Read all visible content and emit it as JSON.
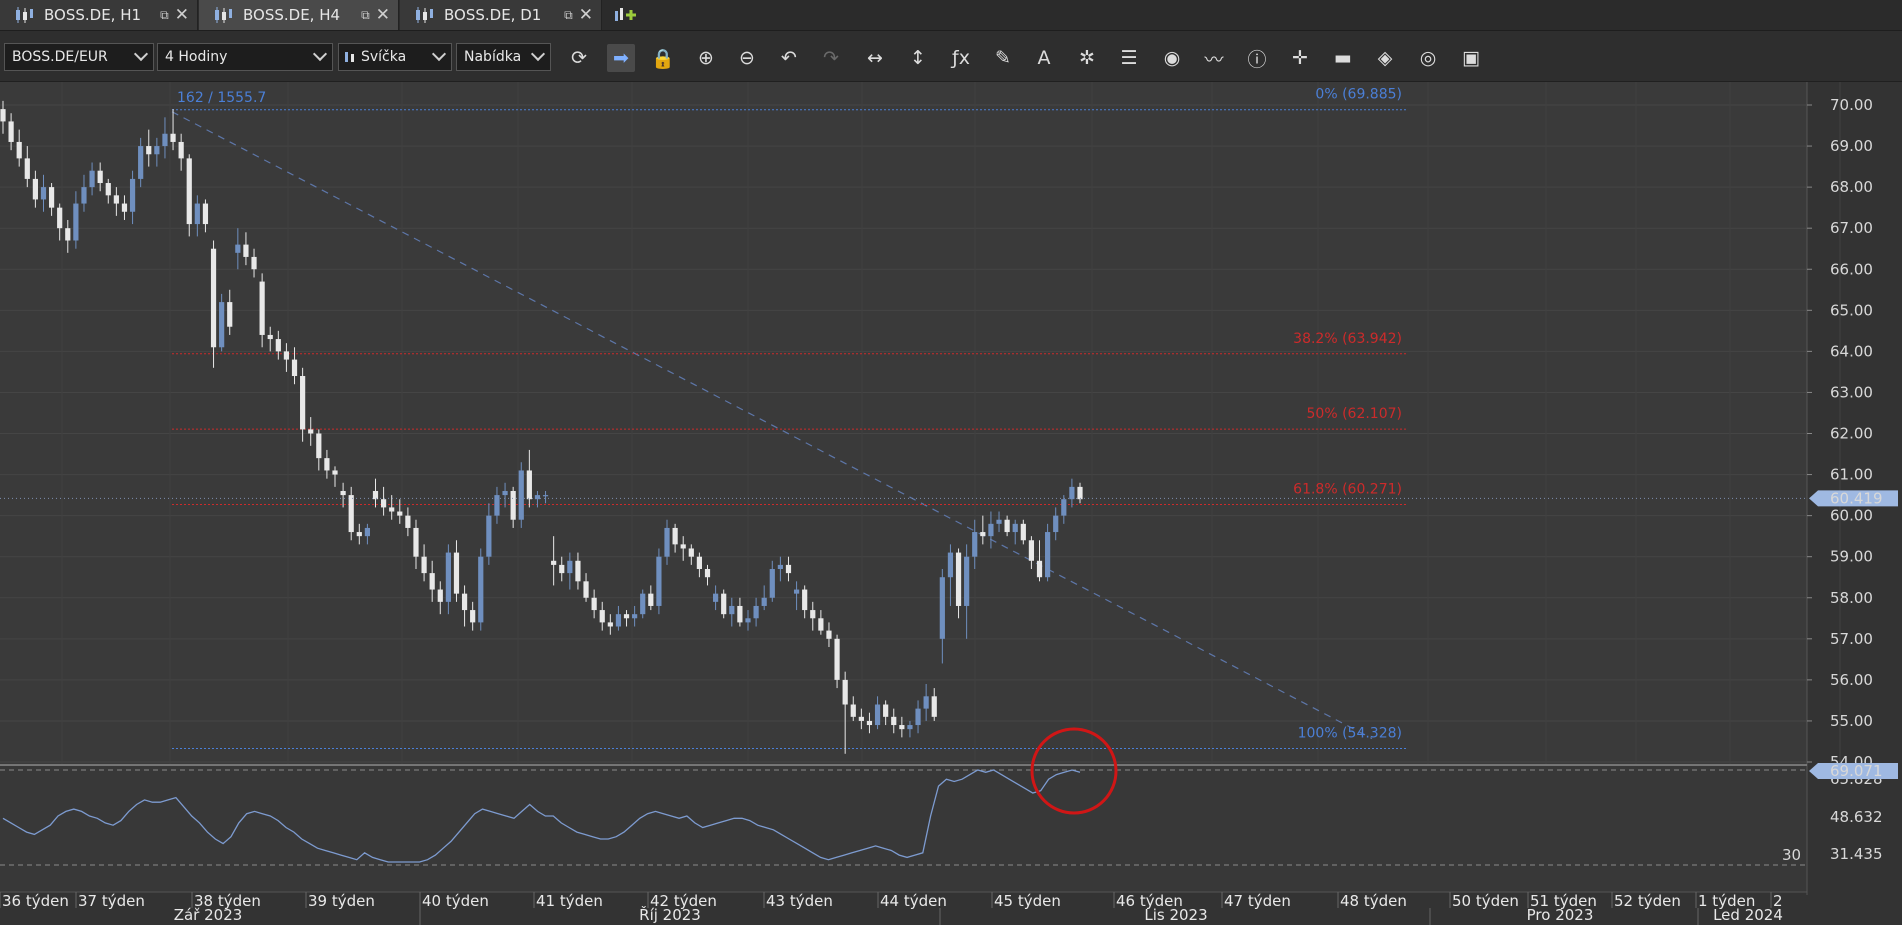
{
  "tabs": [
    {
      "label": "BOSS.DE, H1",
      "active": false
    },
    {
      "label": "BOSS.DE, H4",
      "active": true
    },
    {
      "label": "BOSS.DE, D1",
      "active": false
    }
  ],
  "toolbar": {
    "instrument": "BOSS.DE/EUR",
    "period": "4 Hodiny",
    "chart_type": "Svíčka",
    "offer_side": "Nabídka",
    "icons": [
      "refresh-icon",
      "shift-chart-icon",
      "lock-icon",
      "zoom-in-icon",
      "zoom-out-icon",
      "undo-icon",
      "redo-icon",
      "horizontal-measure-icon",
      "vertical-measure-icon",
      "indicators-icon",
      "pencil-icon",
      "text-icon",
      "crosshair-tools-icon",
      "layers-icon",
      "eye-icon",
      "chart-pattern-icon",
      "info-icon",
      "cursor-icon",
      "color-bars-icon",
      "paint-bucket-icon",
      "cycle-icon",
      "save-icon"
    ]
  },
  "chart_data": {
    "type": "candlestick",
    "instrument": "BOSS.DE",
    "timeframe": "H4",
    "y_ticks": [
      70.0,
      69.0,
      68.0,
      67.0,
      66.0,
      65.0,
      64.0,
      63.0,
      62.0,
      61.0,
      60.0,
      59.0,
      58.0,
      57.0,
      56.0,
      55.0,
      54.0
    ],
    "y_tick_labels": [
      "70.00",
      "69.00",
      "68.00",
      "67.00",
      "66.00",
      "65.00",
      "64.00",
      "63.00",
      "62.00",
      "61.00",
      "60.00",
      "59.00",
      "58.00",
      "57.00",
      "56.00",
      "55.00",
      "54.00"
    ],
    "ylim": [
      54.0,
      70.35
    ],
    "current_price": 60.419,
    "current_price_label": "60.419",
    "fibonacci": {
      "note_label": "162 / 1555.7",
      "levels": [
        {
          "label": "0% (69.885)",
          "value": 69.885,
          "color": "#4b7fd6"
        },
        {
          "label": "38.2% (63.942)",
          "value": 63.942,
          "color": "#cc2b2b"
        },
        {
          "label": "50% (62.107)",
          "value": 62.107,
          "color": "#cc2b2b"
        },
        {
          "label": "61.8% (60.271)",
          "value": 60.271,
          "color": "#cc2b2b"
        },
        {
          "label": "100% (54.328)",
          "value": 54.328,
          "color": "#4b7fd6"
        }
      ]
    },
    "candles": [
      [
        69.9,
        70.1,
        69.3,
        69.6
      ],
      [
        69.6,
        69.8,
        68.9,
        69.1
      ],
      [
        69.1,
        69.4,
        68.5,
        68.7
      ],
      [
        68.7,
        69.0,
        68.0,
        68.2
      ],
      [
        68.2,
        68.4,
        67.5,
        67.7
      ],
      [
        67.7,
        68.3,
        67.4,
        68.0
      ],
      [
        68.0,
        68.1,
        67.3,
        67.5
      ],
      [
        67.5,
        67.6,
        66.7,
        67.0
      ],
      [
        67.0,
        67.2,
        66.4,
        66.7
      ],
      [
        66.7,
        67.9,
        66.5,
        67.6
      ],
      [
        67.6,
        68.3,
        67.4,
        68.0
      ],
      [
        68.0,
        68.6,
        67.8,
        68.4
      ],
      [
        68.4,
        68.6,
        67.9,
        68.1
      ],
      [
        68.1,
        68.2,
        67.6,
        67.8
      ],
      [
        67.8,
        68.0,
        67.3,
        67.6
      ],
      [
        67.6,
        67.8,
        67.2,
        67.4
      ],
      [
        67.4,
        68.4,
        67.1,
        68.2
      ],
      [
        68.2,
        69.2,
        68.0,
        69.0
      ],
      [
        69.0,
        69.4,
        68.5,
        68.8
      ],
      [
        68.8,
        69.2,
        68.5,
        69.0
      ],
      [
        69.0,
        69.7,
        68.7,
        69.3
      ],
      [
        69.3,
        69.9,
        68.9,
        69.1
      ],
      [
        69.1,
        69.3,
        68.4,
        68.7
      ],
      [
        68.7,
        68.8,
        66.8,
        67.1
      ],
      [
        67.1,
        67.8,
        66.8,
        67.6
      ],
      [
        67.6,
        67.7,
        66.9,
        67.1
      ],
      [
        66.5,
        66.7,
        63.6,
        64.1
      ],
      [
        64.1,
        65.4,
        64.0,
        65.2
      ],
      [
        65.2,
        65.5,
        64.4,
        64.6
      ],
      [
        66.4,
        67.0,
        66.0,
        66.6
      ],
      [
        66.6,
        66.9,
        66.1,
        66.3
      ],
      [
        66.3,
        66.5,
        65.8,
        66.0
      ],
      [
        65.7,
        65.9,
        64.1,
        64.4
      ],
      [
        64.4,
        64.6,
        64.0,
        64.3
      ],
      [
        64.3,
        64.5,
        63.8,
        64.0
      ],
      [
        64.0,
        64.2,
        63.5,
        63.8
      ],
      [
        63.8,
        64.1,
        63.2,
        63.4
      ],
      [
        63.4,
        63.6,
        61.8,
        62.1
      ],
      [
        62.1,
        62.4,
        61.7,
        62.0
      ],
      [
        62.0,
        62.1,
        61.1,
        61.4
      ],
      [
        61.4,
        61.6,
        60.9,
        61.1
      ],
      [
        61.1,
        61.2,
        60.7,
        61.0
      ],
      [
        60.6,
        60.8,
        60.2,
        60.5
      ],
      [
        60.5,
        60.7,
        59.4,
        59.6
      ],
      [
        59.6,
        59.8,
        59.3,
        59.5
      ],
      [
        59.5,
        59.8,
        59.3,
        59.7
      ],
      [
        60.6,
        60.9,
        60.2,
        60.4
      ],
      [
        60.4,
        60.7,
        60.0,
        60.2
      ],
      [
        60.2,
        60.5,
        59.9,
        60.1
      ],
      [
        60.1,
        60.4,
        59.8,
        60.0
      ],
      [
        60.0,
        60.2,
        59.5,
        59.7
      ],
      [
        59.7,
        59.9,
        58.7,
        59.0
      ],
      [
        59.0,
        59.3,
        58.4,
        58.6
      ],
      [
        58.6,
        58.9,
        57.9,
        58.2
      ],
      [
        58.2,
        58.4,
        57.6,
        57.9
      ],
      [
        57.9,
        59.3,
        57.6,
        59.1
      ],
      [
        59.1,
        59.4,
        57.9,
        58.1
      ],
      [
        58.1,
        58.3,
        57.3,
        57.7
      ],
      [
        57.7,
        57.9,
        57.2,
        57.4
      ],
      [
        57.4,
        59.2,
        57.2,
        59.0
      ],
      [
        59.0,
        60.3,
        58.8,
        60.0
      ],
      [
        60.0,
        60.7,
        59.8,
        60.5
      ],
      [
        60.5,
        60.8,
        60.2,
        60.6
      ],
      [
        60.6,
        60.7,
        59.7,
        59.9
      ],
      [
        59.9,
        61.3,
        59.7,
        61.1
      ],
      [
        61.1,
        61.6,
        60.2,
        60.4
      ],
      [
        60.4,
        60.6,
        60.2,
        60.5
      ],
      [
        60.5,
        60.6,
        60.3,
        60.5
      ],
      [
        58.9,
        59.5,
        58.3,
        58.8
      ],
      [
        58.8,
        59.0,
        58.4,
        58.6
      ],
      [
        58.6,
        59.1,
        58.2,
        58.9
      ],
      [
        58.9,
        59.1,
        58.2,
        58.4
      ],
      [
        58.4,
        58.6,
        57.9,
        58.0
      ],
      [
        58.0,
        58.2,
        57.5,
        57.7
      ],
      [
        57.7,
        57.9,
        57.2,
        57.4
      ],
      [
        57.4,
        57.6,
        57.1,
        57.3
      ],
      [
        57.3,
        57.8,
        57.2,
        57.6
      ],
      [
        57.6,
        57.7,
        57.3,
        57.5
      ],
      [
        57.5,
        57.8,
        57.3,
        57.6
      ],
      [
        57.6,
        58.2,
        57.5,
        58.1
      ],
      [
        58.1,
        58.3,
        57.7,
        57.8
      ],
      [
        57.8,
        59.2,
        57.6,
        59.0
      ],
      [
        59.0,
        59.9,
        58.8,
        59.7
      ],
      [
        59.7,
        59.8,
        59.1,
        59.3
      ],
      [
        59.3,
        59.5,
        58.9,
        59.2
      ],
      [
        59.2,
        59.3,
        58.8,
        59.0
      ],
      [
        59.0,
        59.1,
        58.5,
        58.7
      ],
      [
        58.7,
        58.8,
        58.3,
        58.5
      ],
      [
        57.9,
        58.3,
        57.7,
        58.1
      ],
      [
        58.1,
        58.2,
        57.5,
        57.6
      ],
      [
        57.6,
        58.0,
        57.3,
        57.8
      ],
      [
        57.8,
        58.0,
        57.3,
        57.4
      ],
      [
        57.4,
        57.7,
        57.2,
        57.5
      ],
      [
        57.5,
        58.0,
        57.3,
        57.8
      ],
      [
        57.8,
        58.3,
        57.7,
        58.0
      ],
      [
        58.0,
        58.9,
        57.9,
        58.7
      ],
      [
        58.7,
        59.0,
        58.4,
        58.8
      ],
      [
        58.8,
        59.0,
        58.4,
        58.6
      ],
      [
        58.1,
        58.4,
        57.7,
        58.2
      ],
      [
        58.2,
        58.3,
        57.5,
        57.7
      ],
      [
        57.7,
        57.9,
        57.2,
        57.5
      ],
      [
        57.5,
        57.7,
        57.1,
        57.2
      ],
      [
        57.2,
        57.4,
        56.8,
        57.0
      ],
      [
        57.0,
        57.1,
        55.8,
        56.0
      ],
      [
        56.0,
        56.2,
        54.2,
        55.4
      ],
      [
        55.4,
        55.6,
        55.0,
        55.1
      ],
      [
        55.1,
        55.3,
        54.8,
        55.0
      ],
      [
        55.0,
        55.2,
        54.7,
        54.9
      ],
      [
        54.9,
        55.6,
        54.8,
        55.4
      ],
      [
        55.4,
        55.5,
        54.9,
        55.1
      ],
      [
        55.1,
        55.3,
        54.7,
        54.9
      ],
      [
        54.9,
        55.1,
        54.6,
        54.8
      ],
      [
        54.8,
        55.0,
        54.6,
        54.9
      ],
      [
        54.9,
        55.5,
        54.7,
        55.3
      ],
      [
        55.3,
        55.9,
        55.0,
        55.6
      ],
      [
        55.6,
        55.8,
        55.0,
        55.1
      ],
      [
        57.0,
        58.7,
        56.4,
        58.5
      ],
      [
        58.5,
        59.3,
        57.8,
        59.1
      ],
      [
        59.1,
        59.2,
        57.5,
        57.8
      ],
      [
        57.8,
        59.3,
        57.0,
        59.0
      ],
      [
        59.0,
        59.9,
        58.7,
        59.6
      ],
      [
        59.6,
        60.0,
        59.3,
        59.5
      ],
      [
        59.5,
        60.1,
        59.2,
        59.8
      ],
      [
        59.8,
        60.1,
        59.6,
        59.9
      ],
      [
        59.9,
        60.0,
        59.5,
        59.6
      ],
      [
        59.6,
        59.9,
        59.3,
        59.8
      ],
      [
        59.8,
        59.9,
        59.3,
        59.4
      ],
      [
        59.4,
        59.5,
        58.7,
        58.9
      ],
      [
        58.9,
        59.4,
        58.4,
        58.5
      ],
      [
        58.5,
        59.8,
        58.4,
        59.6
      ],
      [
        59.6,
        60.2,
        59.4,
        60.0
      ],
      [
        60.0,
        60.5,
        59.8,
        60.4
      ],
      [
        60.4,
        60.9,
        60.2,
        60.7
      ],
      [
        60.7,
        60.8,
        60.3,
        60.4
      ]
    ],
    "rsi": {
      "y_tick_labels": [
        "65.828",
        "48.632",
        "31.435"
      ],
      "level_label": "30",
      "current_label": "69.071",
      "values": [
        49,
        47,
        45,
        43,
        42,
        44,
        46,
        50,
        52,
        53,
        52,
        50,
        49,
        47,
        46,
        48,
        52,
        55,
        57,
        56,
        56,
        57,
        58,
        54,
        50,
        47,
        43,
        40,
        38,
        41,
        47,
        51,
        52,
        51,
        50,
        48,
        45,
        43,
        40,
        38,
        36,
        35,
        34,
        33,
        32,
        31,
        34,
        32,
        31,
        30,
        30,
        30,
        30,
        30,
        31,
        33,
        36,
        39,
        43,
        47,
        51,
        53,
        52,
        51,
        50,
        49,
        52,
        55,
        52,
        50,
        50,
        47,
        45,
        43,
        42,
        41,
        40,
        40,
        41,
        43,
        46,
        49,
        51,
        52,
        51,
        50,
        49,
        50,
        47,
        45,
        46,
        47,
        48,
        49,
        49,
        48,
        46,
        45,
        44,
        42,
        40,
        38,
        36,
        34,
        32,
        31,
        32,
        33,
        34,
        35,
        36,
        37,
        36,
        35,
        33,
        32,
        33,
        34,
        50,
        63,
        66,
        65,
        66,
        68,
        70,
        69,
        70,
        68,
        66,
        64,
        62,
        60,
        61,
        66,
        68,
        69,
        70,
        69
      ]
    },
    "x_labels": [
      "36 týden",
      "37 týden",
      "38 týden",
      "39 týden",
      "40 týden",
      "41 týden",
      "42 týden",
      "43 týden",
      "44 týden",
      "45 týden",
      "46 týden",
      "47 týden",
      "48 týden",
      "50 týden",
      "51 týden",
      "52 týden",
      "1 týden",
      "2"
    ],
    "month_labels": [
      "Zář 2023",
      "Říj 2023",
      "Lis 2023",
      "Pro 2023",
      "Led 2024"
    ]
  },
  "colors": {
    "background": "#3a3a3a",
    "bull": "#6f8fbf",
    "bear": "#e8e8e8",
    "fib_blue": "#4b7fd6",
    "fib_red": "#cc2b2b",
    "rsi_line": "#7d9bd0",
    "annotation_circle": "#d01616"
  }
}
